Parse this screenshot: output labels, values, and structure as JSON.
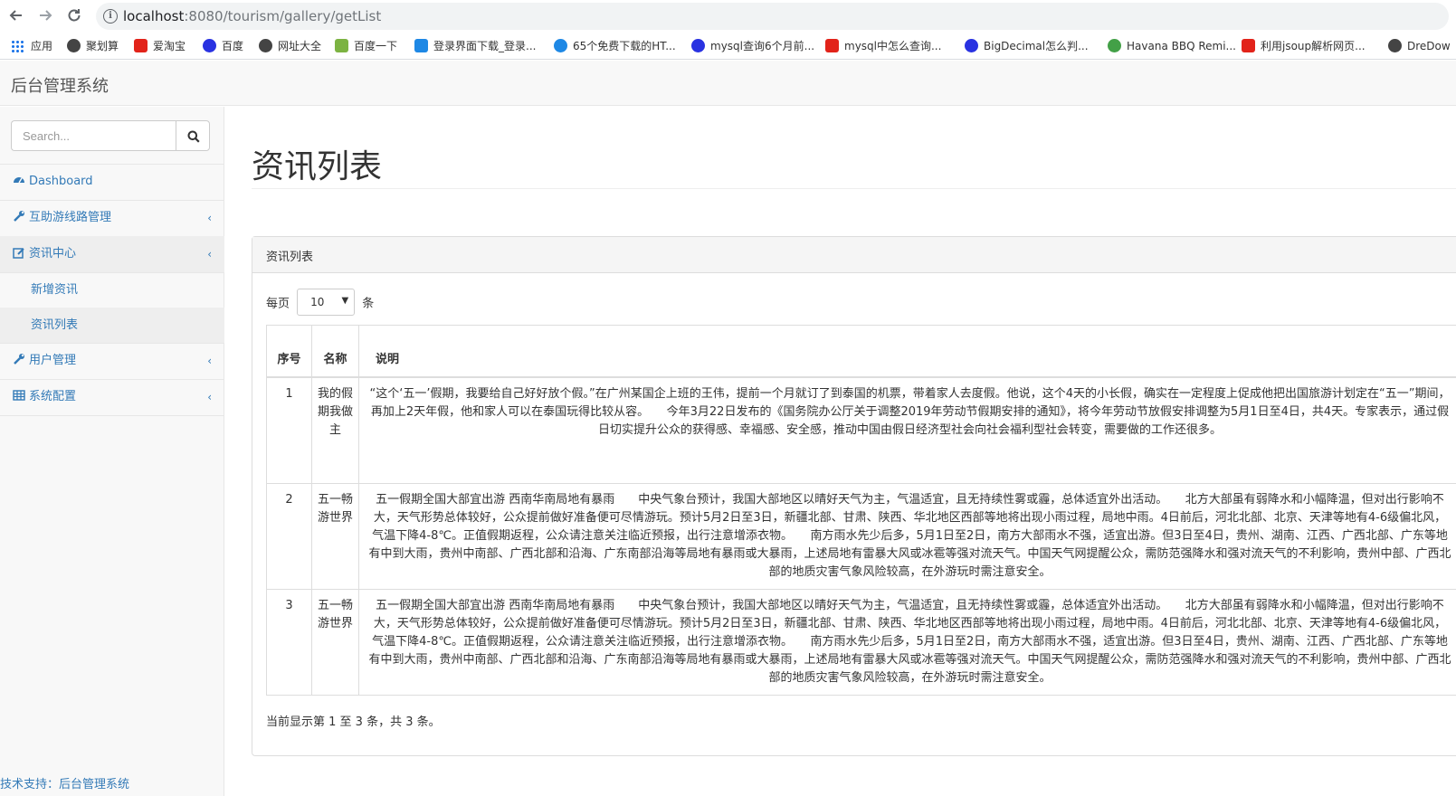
{
  "browser": {
    "url_host": "localhost",
    "url_rest": ":8080/tourism/gallery/getList",
    "bookmarks": [
      {
        "label": "应用",
        "color": "#1a73e8"
      },
      {
        "label": "聚划算",
        "color": "#444444"
      },
      {
        "label": "爱淘宝",
        "color": "#e2231a"
      },
      {
        "label": "百度",
        "color": "#2932e1"
      },
      {
        "label": "网址大全",
        "color": "#444444"
      },
      {
        "label": "百度一下",
        "color": "#7cb342"
      },
      {
        "label": "登录界面下载_登录...",
        "color": "#1e88e5"
      },
      {
        "label": "65个免费下载的HT...",
        "color": "#1e88e5"
      },
      {
        "label": "mysql查询6个月前...",
        "color": "#2932e1"
      },
      {
        "label": "mysql中怎么查询...",
        "color": "#e2231a"
      },
      {
        "label": "BigDecimal怎么判...",
        "color": "#2932e1"
      },
      {
        "label": "Havana BBQ Remi...",
        "color": "#43a047"
      },
      {
        "label": "利用jsoup解析网页...",
        "color": "#e2231a"
      },
      {
        "label": "DreDow",
        "color": "#444444"
      }
    ]
  },
  "header": {
    "brand": "后台管理系统"
  },
  "sidebar": {
    "search_placeholder": "Search...",
    "items": [
      {
        "label": "Dashboard"
      },
      {
        "label": "互助游线路管理",
        "chevron": "‹"
      },
      {
        "label": "资讯中心",
        "chevron": "‹"
      },
      {
        "label": "用户管理",
        "chevron": "‹"
      },
      {
        "label": "系统配置",
        "chevron": "‹"
      }
    ],
    "subitems": [
      {
        "label": "新增资讯"
      },
      {
        "label": "资讯列表"
      }
    ]
  },
  "main": {
    "title": "资讯列表",
    "panel_heading": "资讯列表",
    "length_prefix": "每页",
    "length_value": "10",
    "length_suffix": "条",
    "columns": [
      "序号",
      "名称",
      "说明"
    ],
    "rows": [
      {
        "index": "1",
        "name": "我的假期我做主",
        "desc": "“这个‘五一’假期，我要给自己好好放个假。”在广州某国企上班的王伟，提前一个月就订了到泰国的机票，带着家人去度假。他说，这个4天的小长假，确实在一定程度上促成他把出国旅游计划定在“五一”期间，再加上2天年假，他和家人可以在泰国玩得比较从容。　　今年3月22日发布的《国务院办公厅关于调整2019年劳动节假期安排的通知》，将今年劳动节放假安排调整为5月1日至4日，共4天。专家表示，通过假日切实提升公众的获得感、幸福感、安全感，推动中国由假日经济型社会向社会福利型社会转变，需要做的工作还很多。"
      },
      {
        "index": "2",
        "name": "五一畅游世界",
        "desc": "五一假期全国大部宜出游 西南华南局地有暴雨　　中央气象台预计，我国大部地区以晴好天气为主，气温适宜，且无持续性雾或霾，总体适宜外出活动。　　北方大部虽有弱降水和小幅降温，但对出行影响不大，天气形势总体较好，公众提前做好准备便可尽情游玩。预计5月2日至3日，新疆北部、甘肃、陕西、华北地区西部等地将出现小雨过程，局地中雨。4日前后，河北北部、北京、天津等地有4-6级偏北风，气温下降4-8℃。正值假期返程，公众请注意关注临近预报，出行注意增添衣物。　　南方雨水先少后多，5月1日至2日，南方大部雨水不强，适宜出游。但3日至4日，贵州、湖南、江西、广西北部、广东等地有中到大雨，贵州中南部、广西北部和沿海、广东南部沿海等局地有暴雨或大暴雨，上述局地有雷暴大风或冰雹等强对流天气。中国天气网提醒公众，需防范强降水和强对流天气的不利影响，贵州中部、广西北部的地质灾害气象风险较高，在外游玩时需注意安全。"
      },
      {
        "index": "3",
        "name": "五一畅游世界",
        "desc": "五一假期全国大部宜出游 西南华南局地有暴雨　　中央气象台预计，我国大部地区以晴好天气为主，气温适宜，且无持续性雾或霾，总体适宜外出活动。　　北方大部虽有弱降水和小幅降温，但对出行影响不大，天气形势总体较好，公众提前做好准备便可尽情游玩。预计5月2日至3日，新疆北部、甘肃、陕西、华北地区西部等地将出现小雨过程，局地中雨。4日前后，河北北部、北京、天津等地有4-6级偏北风，气温下降4-8℃。正值假期返程，公众请注意关注临近预报，出行注意增添衣物。　　南方雨水先少后多，5月1日至2日，南方大部雨水不强，适宜出游。但3日至4日，贵州、湖南、江西、广西北部、广东等地有中到大雨，贵州中南部、广西北部和沿海、广东南部沿海等局地有暴雨或大暴雨，上述局地有雷暴大风或冰雹等强对流天气。中国天气网提醒公众，需防范强降水和强对流天气的不利影响，贵州中部、广西北部的地质灾害气象风险较高，在外游玩时需注意安全。"
      }
    ],
    "info": "当前显示第 1 至 3 条，共 3 条。"
  },
  "footer": {
    "text": "技术支持：后台管理系统"
  },
  "colors": {
    "link": "#337ab7",
    "border": "#dddddd",
    "panel_heading_bg": "#f5f5f5",
    "sidebar_bg": "#f8f8f8"
  }
}
